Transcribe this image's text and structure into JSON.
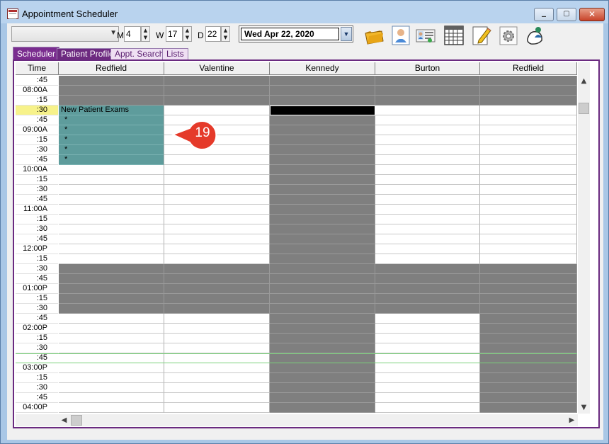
{
  "window": {
    "title": "Appointment Scheduler"
  },
  "toolbar": {
    "combo_value": "",
    "month_label": "M",
    "month_value": "4",
    "week_label": "W",
    "week_value": "17",
    "day_label": "D",
    "day_value": "22",
    "date_value": "Wed  Apr 22, 2020",
    "tools": [
      "folder-icon",
      "provider-icon",
      "id-card-icon",
      "calendar-icon",
      "edit-icon",
      "settings-icon",
      "help-person-icon"
    ]
  },
  "tabs": [
    {
      "label": "Scheduler",
      "active": true
    },
    {
      "label": "Patient Profile"
    },
    {
      "label": "Appt. Search"
    },
    {
      "label": "Lists"
    }
  ],
  "grid": {
    "time_header": "Time",
    "providers": [
      "Redfield",
      "Valentine",
      "Kennedy",
      "Burton",
      "Redfield"
    ],
    "times": [
      ":45",
      "08:00A",
      ":15",
      ":30",
      ":45",
      "09:00A",
      ":15",
      ":30",
      ":45",
      "10:00A",
      ":15",
      ":30",
      ":45",
      "11:00A",
      ":15",
      ":30",
      ":45",
      "12:00P",
      ":15",
      ":30",
      ":45",
      "01:00P",
      ":15",
      ":30",
      ":45",
      "02:00P",
      ":15",
      ":30",
      ":45",
      "03:00P",
      ":15",
      ":30",
      ":45",
      "04:00P"
    ],
    "appointment_title": "New Patient Exams",
    "appointment_marker": "*",
    "selected_time": ":30",
    "current_time_row": ":45"
  },
  "callout": {
    "number": "19"
  }
}
